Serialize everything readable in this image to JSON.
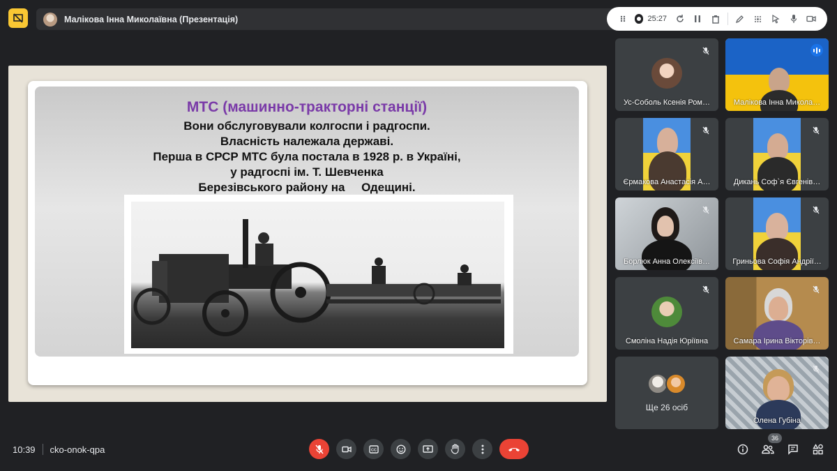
{
  "header": {
    "presenter_label": "Малікова Інна Миколаївна (Презентація)",
    "recording_time": "25:27"
  },
  "slide": {
    "title": "МТС (машинно-тракторні станції)",
    "lines": [
      "Вони обслуговували колгоспи і радгоспи.",
      "Власність належала державі.",
      "Перша в СРСР МТС була постала в 1928 р. в Україні,",
      "у радгоспі ім. Т. Шевченка",
      "Березівського району на     Одещині."
    ],
    "title_color": "#7a3aa8"
  },
  "participants": [
    {
      "name": "Ус-Соболь Ксенія Ром…"
    },
    {
      "name": "Малікова Інна Микола…"
    },
    {
      "name": "Єрмакова Анастасія А…"
    },
    {
      "name": "Дикань Соф`я Євгенів…"
    },
    {
      "name": "Борлюк Анна Олексіїв…"
    },
    {
      "name": "Гриньова Софія Андрії…"
    },
    {
      "name": "Смоліна Надія Юріївна"
    },
    {
      "name": "Самара Ірина Вікторів…"
    },
    {
      "more_label": "Ще 26 осіб"
    },
    {
      "name": "Олена Губіна"
    }
  ],
  "footer": {
    "time": "10:39",
    "meeting_code": "cko-onok-qpa",
    "participant_count": "36"
  },
  "colors": {
    "accent": "#8ab4f8",
    "end_call": "#ea4335",
    "background": "#202124"
  },
  "icons": {
    "stop_present": "present-off-icon",
    "mic_off": "mic-off-icon",
    "camera": "camera-icon",
    "captions": "captions-icon",
    "emoji": "emoji-icon",
    "present": "present-screen-icon",
    "raise_hand": "hand-icon",
    "more": "more-vert-icon",
    "end_call": "end-call-icon",
    "info": "info-icon",
    "people": "people-icon",
    "chat": "chat-icon",
    "activities": "activities-icon"
  }
}
